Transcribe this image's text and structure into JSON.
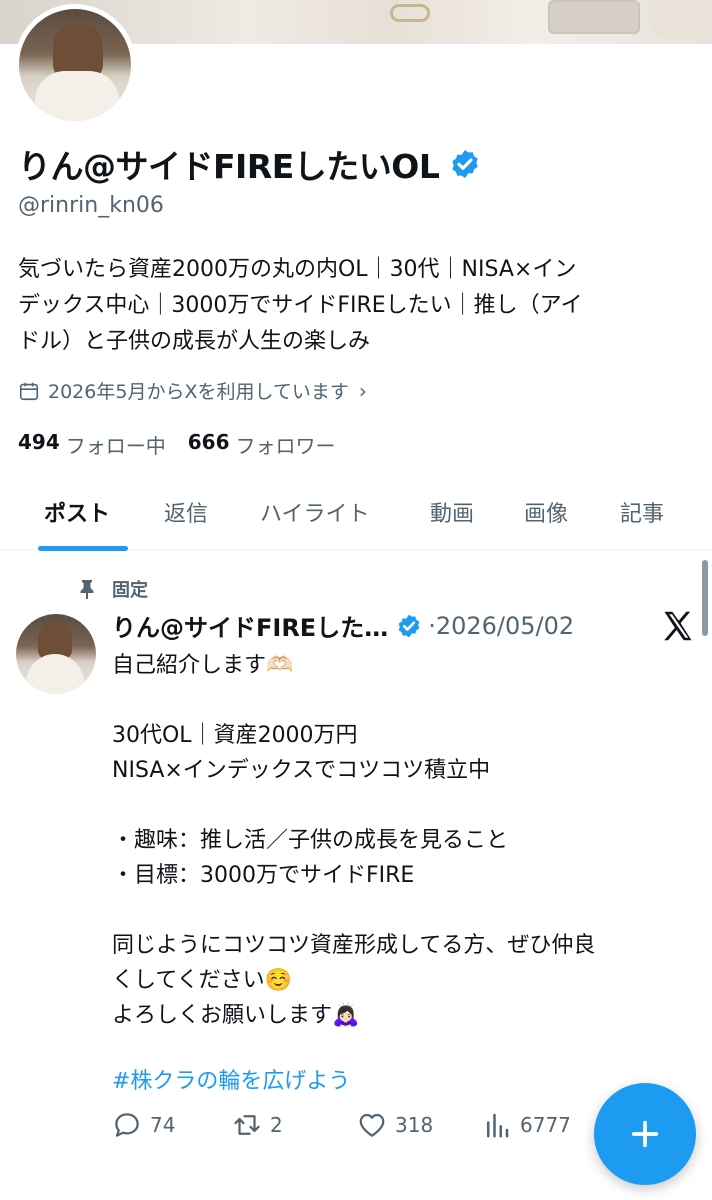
{
  "profile": {
    "display_name": "りん@サイドFIREしたいOL",
    "handle": "@rinrin_kn06",
    "bio_lines": [
      "気づいたら資産2000万の丸の内OL｜30代｜NISA×イン",
      "デックス中心｜3000万でサイドFIREしたい｜推し（アイ",
      "ドル）と子供の成長が人生の楽しみ"
    ],
    "joined": "2026年5月からXを利用しています",
    "following_count": "494",
    "following_label": "フォロー中",
    "followers_count": "666",
    "followers_label": "フォロワー"
  },
  "tabs": [
    {
      "label": "ポスト",
      "active": true
    },
    {
      "label": "返信",
      "active": false
    },
    {
      "label": "ハイライト",
      "active": false
    },
    {
      "label": "動画",
      "active": false
    },
    {
      "label": "画像",
      "active": false
    },
    {
      "label": "記事",
      "active": false
    }
  ],
  "pinned_post": {
    "pinned_label": "固定",
    "author_name": "りん@サイドFIREした…",
    "date": "·2026/05/02",
    "body_lines": [
      "自己紹介します🫶🏻",
      "",
      "30代OL｜資産2000万円",
      "NISA×インデックスでコツコツ積立中",
      "",
      "・趣味：推し活／子供の成長を見ること",
      "・目標：3000万でサイドFIRE",
      "",
      "同じようにコツコツ資産形成してる方、ぜひ仲良",
      "くしてください☺️",
      "よろしくお願いします🙇🏻‍♀️"
    ],
    "hashtag": "#株クラの輪を広げよう",
    "replies": "74",
    "reposts": "2",
    "likes": "318",
    "views": "6777"
  },
  "colors": {
    "accent": "#1d9bf0",
    "text_primary": "#0f1419",
    "text_secondary": "#536471"
  },
  "icons": [
    "verified-badge-icon",
    "calendar-icon",
    "chevron-right-icon",
    "pin-icon",
    "x-logo-icon",
    "reply-icon",
    "repost-icon",
    "like-icon",
    "views-icon",
    "plus-icon"
  ]
}
